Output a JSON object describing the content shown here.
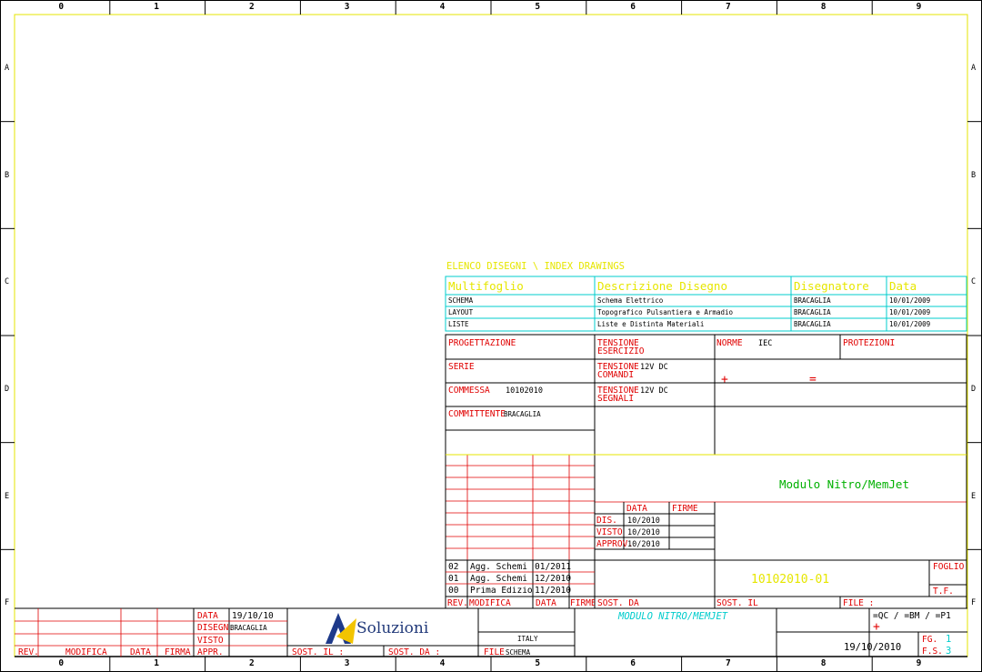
{
  "frame": {
    "columns": [
      "0",
      "1",
      "2",
      "3",
      "4",
      "5",
      "6",
      "7",
      "8",
      "9"
    ],
    "rows": [
      "A",
      "B",
      "C",
      "D",
      "E",
      "F"
    ],
    "colors": {
      "frame": "#e6e600",
      "red": "#e00000",
      "cyan": "#00cccc",
      "green": "#00b000",
      "black": "#000000"
    }
  },
  "index": {
    "title": "ELENCO DISEGNI \\ INDEX DRAWINGS",
    "headers": [
      "Multifoglio",
      "Descrizione Disegno",
      "Disegnatore",
      "Data"
    ],
    "rows": [
      [
        "SCHEMA",
        "Schema Elettrico",
        "BRACAGLIA",
        "10/01/2009"
      ],
      [
        "LAYOUT",
        "Topografico Pulsantiera e Armadio",
        "BRACAGLIA",
        "10/01/2009"
      ],
      [
        "LISTE",
        "Liste e Distinta Materiali",
        "BRACAGLIA",
        "10/01/2009"
      ]
    ]
  },
  "project": {
    "progettazione_label": "PROGETTAZIONE",
    "tensione_esercizio_label": [
      "TENSIONE",
      "ESERCIZIO"
    ],
    "norme_label": "NORME",
    "norme_value": "IEC",
    "protezioni_label": "PROTEZIONI",
    "serie_label": "SERIE",
    "tensione_comandi_label": [
      "TENSIONE",
      "COMANDI"
    ],
    "tensione_comandi_value": "12V DC",
    "commessa_label": "COMMESSA",
    "commessa_value": "10102010",
    "tensione_segnali_label": [
      "TENSIONE",
      "SEGNALI"
    ],
    "tensione_segnali_value": "12V DC",
    "committente_label": "COMMITTENTE",
    "committente_value": "BRACAGLIA",
    "plus_mark": "+",
    "equal_mark": "="
  },
  "title_block": {
    "drawing_title": "Modulo Nitro/MemJet",
    "sign_headers": [
      "DATA",
      "FIRME"
    ],
    "sign_rows": [
      {
        "label": "DIS.",
        "date": "10/2010"
      },
      {
        "label": "VISTO",
        "date": "10/2010"
      },
      {
        "label": "APPROV.",
        "date": "10/2010"
      }
    ],
    "revisions": [
      {
        "rev": "02",
        "mod": "Agg. Schemi",
        "data": "01/2011"
      },
      {
        "rev": "01",
        "mod": "Agg. Schemi",
        "data": "12/2010"
      },
      {
        "rev": "00",
        "mod": "Prima Edizione",
        "data": "11/2010"
      }
    ],
    "rev_headers": [
      "REV.",
      "MODIFICA",
      "DATA",
      "FIRME"
    ],
    "sost_da_label": "SOST. DA",
    "sost_il_label": "SOST. IL",
    "file_label": "FILE :",
    "doc_number": "10102010-01",
    "foglio_label": "FOGLIO",
    "tf_label": "T.F."
  },
  "bottom_left": {
    "headers": [
      "REV.",
      "MODIFICA",
      "DATA",
      "FIRMA"
    ],
    "data_label": "DATA",
    "data_value": "19/10/10",
    "disegn_label": "DISEGN.",
    "disegn_value": "BRACAGLIA",
    "visto_label": "VISTO",
    "appr_label": "APPR.",
    "sost_il_label": "SOST. IL :",
    "sost_da_label": "SOST. DA :",
    "company": "Soluzioni",
    "country": "ITALY",
    "file_label": "FILE",
    "file_value": "SCHEMA",
    "module_title": "MODULO NITRO/MEMJET",
    "ref": "=QC / =BM / =P1",
    "ref_plus": "+",
    "date": "19/10/2010",
    "fg_label": "FG.",
    "fg_value": "1",
    "fs_label": "F.S.",
    "fs_value": "3"
  }
}
